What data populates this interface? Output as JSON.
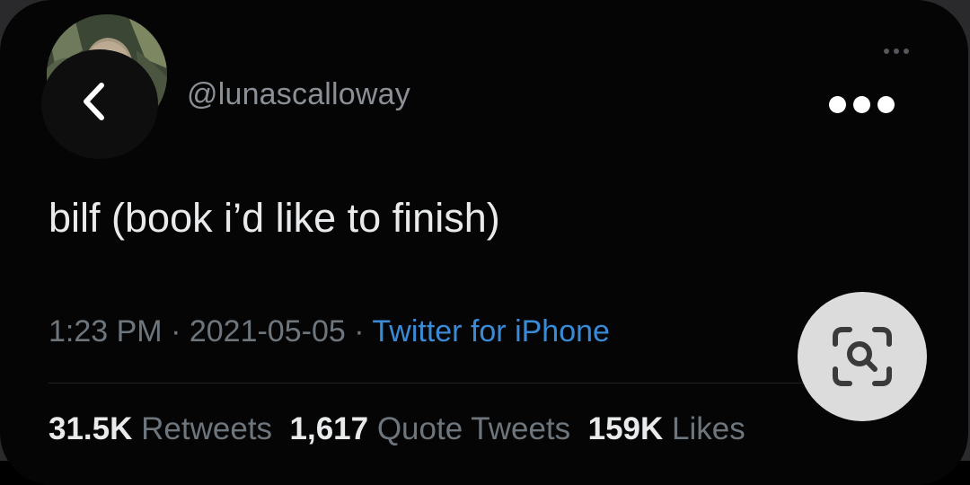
{
  "tweet": {
    "handle": "@lunascalloway",
    "text": "bilf (book i’d like to finish)",
    "time": "1:23 PM",
    "separator": " · ",
    "date": "2021-05-05",
    "source": "Twitter for iPhone"
  },
  "stats": {
    "retweets_count": "31.5K",
    "retweets_label": "Retweets",
    "quotes_count": "1,617",
    "quotes_label": "Quote Tweets",
    "likes_count": "159K",
    "likes_label": "Likes"
  },
  "icons": {
    "back": "chevron-left-icon",
    "more": "more-horizontal-icon",
    "lens": "image-search-icon"
  },
  "colors": {
    "background": "#050505",
    "link": "#3a8ad6",
    "secondary_text": "#6e767d"
  }
}
